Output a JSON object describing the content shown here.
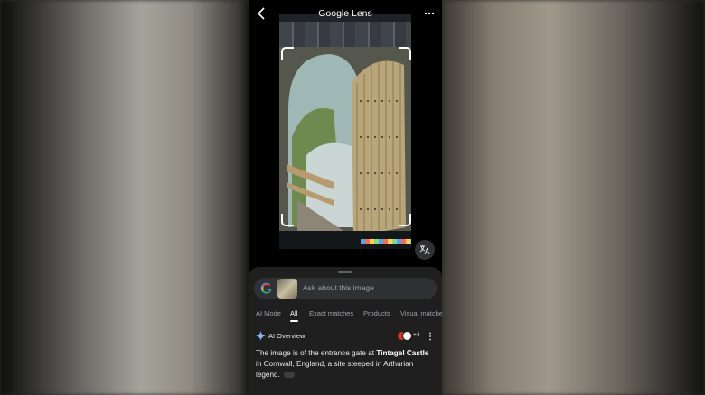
{
  "header": {
    "title": "Google Lens"
  },
  "search": {
    "placeholder": "Ask about this image"
  },
  "tabs": [
    "AI Mode",
    "All",
    "Exact matches",
    "Products",
    "Visual matches"
  ],
  "ai_overview": {
    "label": "AI Overview",
    "source_count": "+4",
    "text_before": "The image is of the entrance gate at ",
    "text_bold": "Tintagel Castle",
    "text_after": " in Cornwall, England, a site steeped in Arthurian legend."
  },
  "icons": [
    "back-icon",
    "more-icon",
    "translate-icon",
    "google-g-icon",
    "sparkle-icon",
    "kebab-icon",
    "link-icon"
  ]
}
